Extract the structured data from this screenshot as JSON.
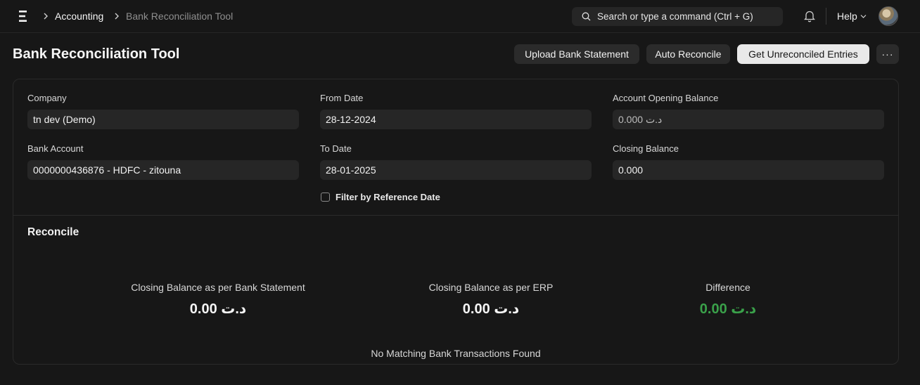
{
  "navbar": {
    "breadcrumbs": [
      "Accounting",
      "Bank Reconciliation Tool"
    ],
    "search_placeholder": "Search or type a command (Ctrl + G)",
    "help_label": "Help"
  },
  "page": {
    "title": "Bank Reconciliation Tool",
    "actions": {
      "upload": "Upload Bank Statement",
      "auto": "Auto Reconcile",
      "get_unreconciled": "Get Unreconciled Entries",
      "more": "···"
    }
  },
  "form": {
    "company": {
      "label": "Company",
      "value": "tn dev (Demo)"
    },
    "bank_account": {
      "label": "Bank Account",
      "value": "0000000436876 - HDFC - zitouna"
    },
    "from_date": {
      "label": "From Date",
      "value": "28-12-2024"
    },
    "to_date": {
      "label": "To Date",
      "value": "28-01-2025"
    },
    "opening_balance": {
      "label": "Account Opening Balance",
      "value": "0.000 د.ت"
    },
    "closing_balance": {
      "label": "Closing Balance",
      "value": "0.000"
    },
    "filter_ref_date": {
      "label": "Filter by Reference Date",
      "checked": false
    }
  },
  "reconcile": {
    "title": "Reconcile",
    "stats": [
      {
        "label": "Closing Balance as per Bank Statement",
        "value": "0.00 د.ت"
      },
      {
        "label": "Closing Balance as per ERP",
        "value": "0.00 د.ت"
      },
      {
        "label": "Difference",
        "value": "0.00 د.ت",
        "color": "#3aa14a"
      }
    ],
    "empty_message": "No Matching Bank Transactions Found"
  }
}
